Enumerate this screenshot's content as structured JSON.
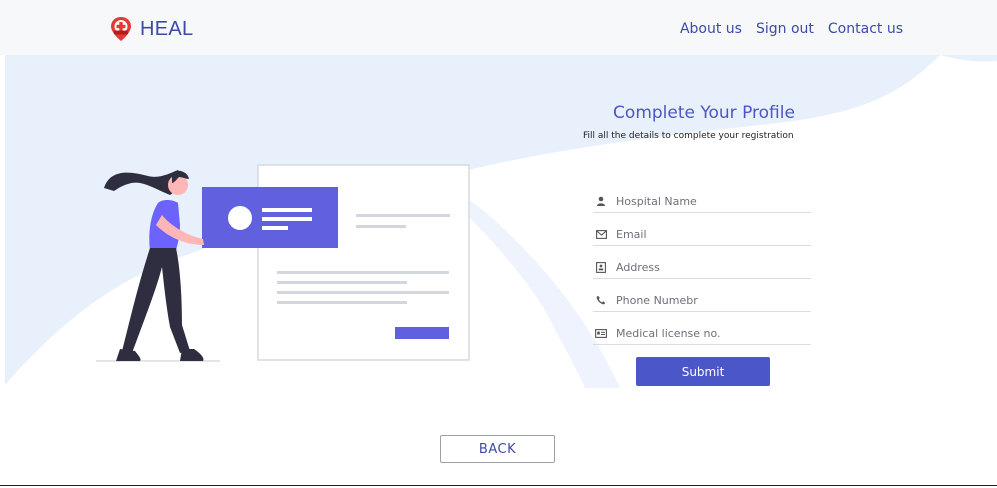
{
  "navbar": {
    "brand": "HEAL",
    "links": [
      "About us",
      "Sign out",
      "Contact us"
    ]
  },
  "profile": {
    "title": "Complete Your Profile",
    "subtitle": "Fill all the details to complete your registration"
  },
  "form": {
    "fields": [
      {
        "placeholder": "Hospital Name",
        "icon": "user-icon"
      },
      {
        "placeholder": "Email",
        "icon": "envelope-icon"
      },
      {
        "placeholder": "Address",
        "icon": "address-card-icon"
      },
      {
        "placeholder": "Phone Numebr",
        "icon": "phone-icon"
      },
      {
        "placeholder": "Medical license no.",
        "icon": "id-card-icon"
      }
    ],
    "submit_label": "Submit"
  },
  "back_label": "BACK",
  "colors": {
    "accent": "#4b56c9",
    "brand_text": "#3d4aa8",
    "hero_bg": "#e8f0fc",
    "logo_red": "#e53935"
  }
}
